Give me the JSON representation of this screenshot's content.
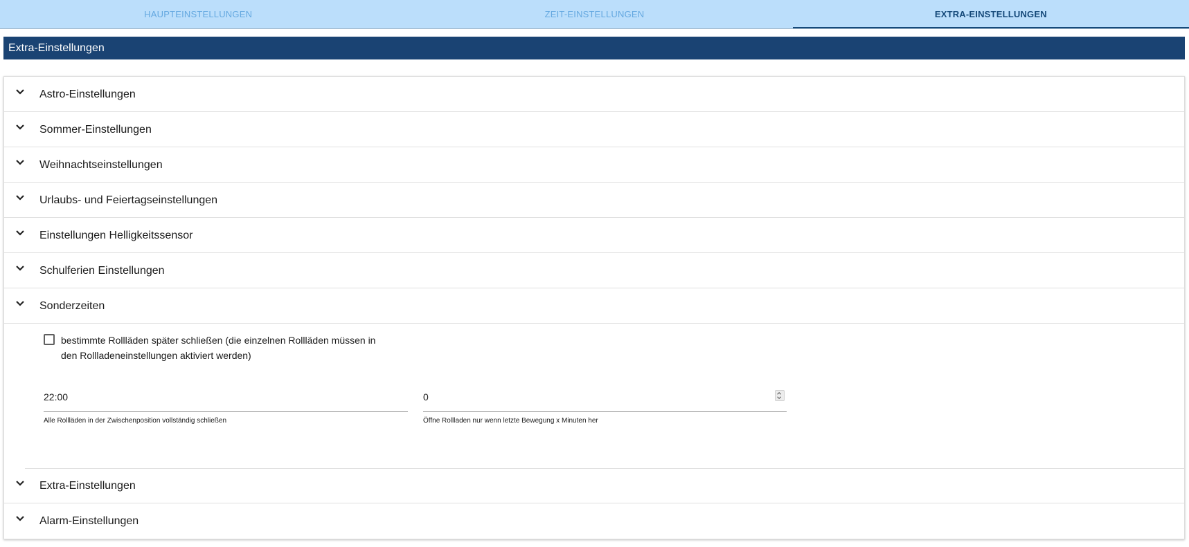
{
  "tabs": [
    {
      "label": "HAUPTEINSTELLUNGEN"
    },
    {
      "label": "ZEIT-EINSTELLUNGEN"
    },
    {
      "label": "EXTRA-EINSTELLUNGEN"
    }
  ],
  "active_tab": "EXTRA-EINSTELLUNGEN",
  "section_title": "Extra-Einstellungen",
  "accordion": {
    "items": [
      {
        "label": "Astro-Einstellungen"
      },
      {
        "label": "Sommer-Einstellungen"
      },
      {
        "label": "Weihnachtseinstellungen"
      },
      {
        "label": "Urlaubs- und Feiertagseinstellungen"
      },
      {
        "label": "Einstellungen Helligkeitssensor"
      },
      {
        "label": "Schulferien Einstellungen"
      },
      {
        "label": "Sonderzeiten"
      },
      {
        "label": "Extra-Einstellungen"
      },
      {
        "label": "Alarm-Einstellungen"
      }
    ],
    "expanded": "Sonderzeiten"
  },
  "sonderzeiten": {
    "checkbox_label": "bestimmte Rollläden später schließen (die einzelnen Rollläden müssen in den Rollladeneinstellungen aktiviert werden)",
    "checkbox_checked": false,
    "time_field": {
      "value": "22:00",
      "helper": "Alle Rollläden in der Zwischenposition vollständig schließen"
    },
    "minutes_field": {
      "value": "0",
      "helper": "Öffne Rollladen nur wenn letzte Bewegung x Minuten her"
    }
  },
  "colors": {
    "tab_bar": "#bbdefb",
    "tab_inactive": "#64a8e0",
    "tab_active": "#164a7a",
    "section_header": "#1a4373"
  }
}
